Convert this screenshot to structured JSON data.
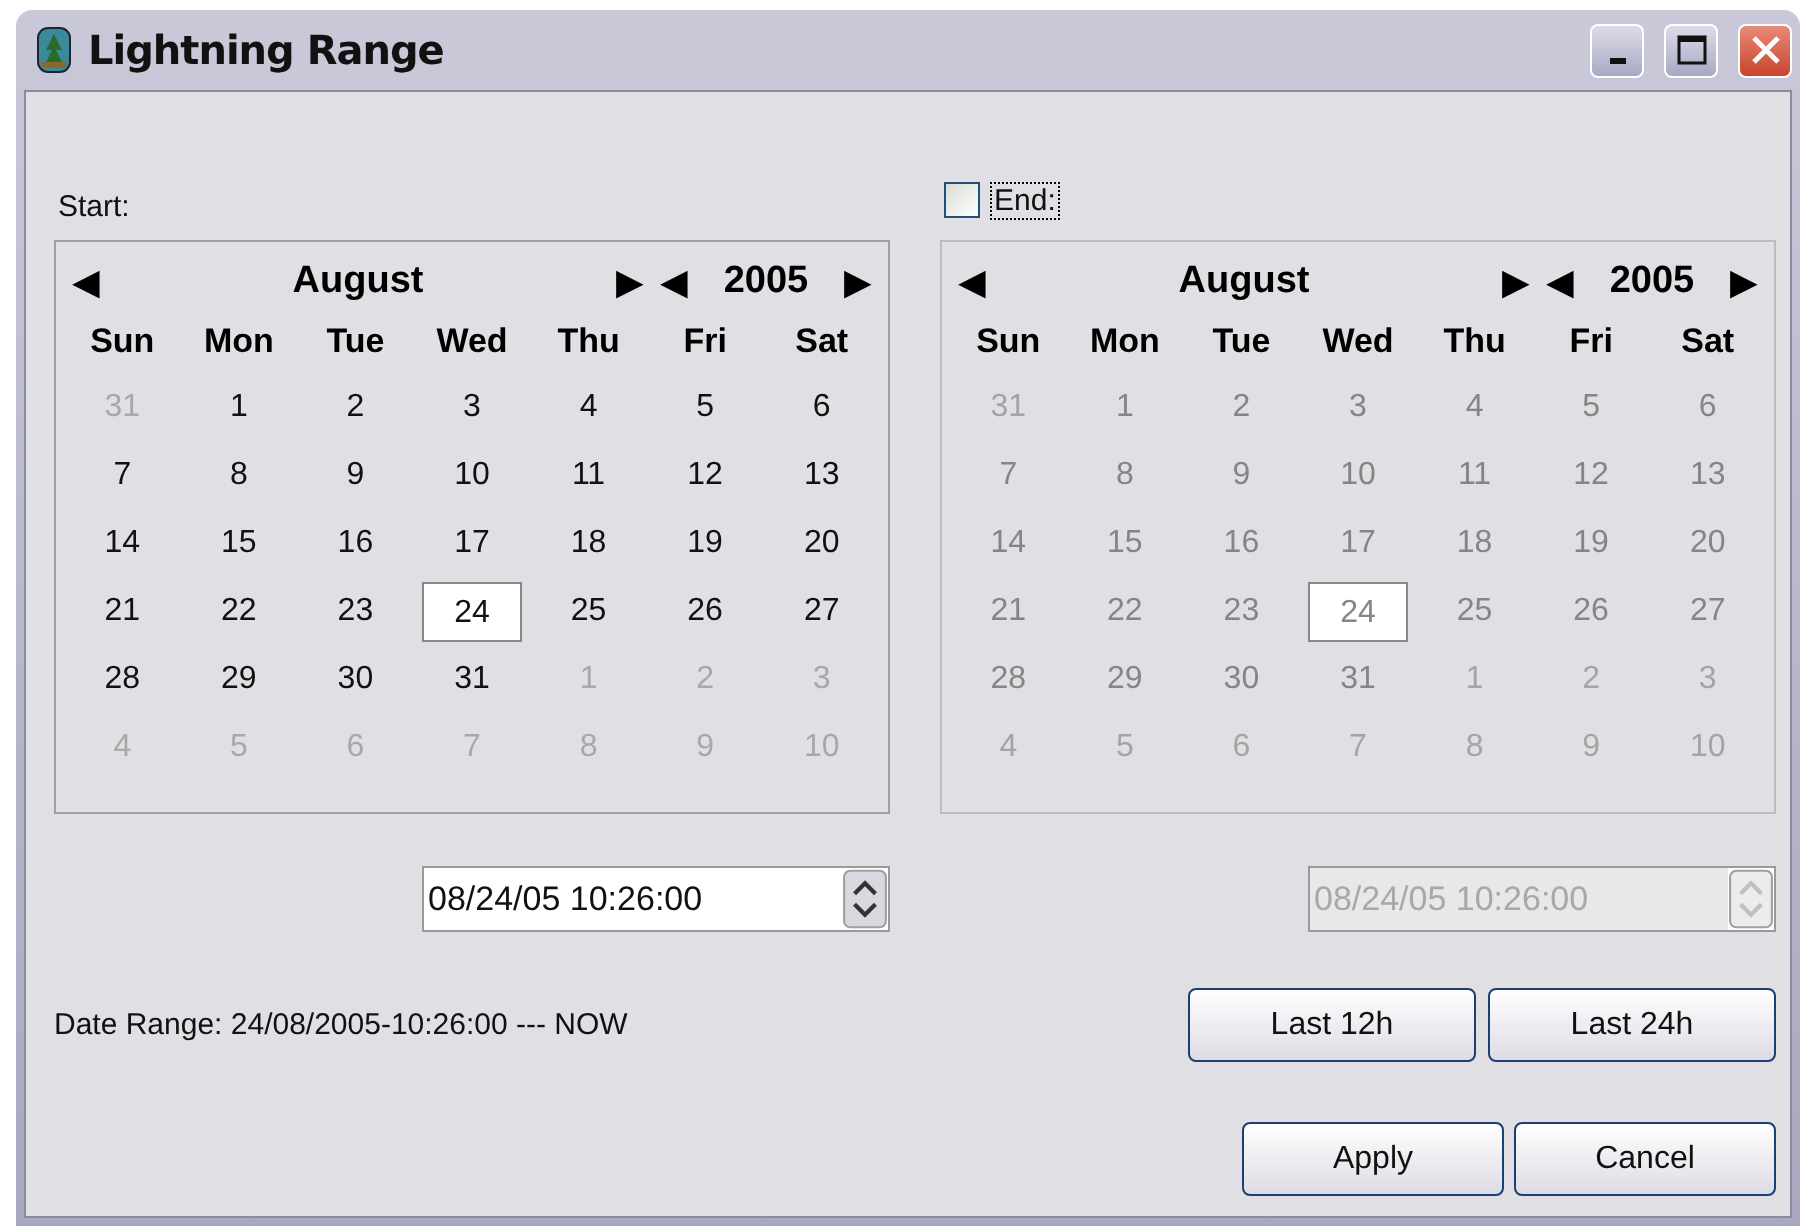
{
  "window": {
    "title": "Lightning Range"
  },
  "calendars": [
    {
      "header": {
        "kind": "label",
        "text": "Start:"
      },
      "disabled": false,
      "prev_month": "◀",
      "month": "August",
      "next_month": "▶",
      "prev_year": "◀",
      "year": "2005",
      "next_year": "▶",
      "weekdays": [
        "Sun",
        "Mon",
        "Tue",
        "Wed",
        "Thu",
        "Fri",
        "Sat"
      ],
      "weeks": [
        [
          {
            "d": "31",
            "outside": true,
            "selected": false
          },
          {
            "d": "1",
            "outside": false,
            "selected": false
          },
          {
            "d": "2",
            "outside": false,
            "selected": false
          },
          {
            "d": "3",
            "outside": false,
            "selected": false
          },
          {
            "d": "4",
            "outside": false,
            "selected": false
          },
          {
            "d": "5",
            "outside": false,
            "selected": false
          },
          {
            "d": "6",
            "outside": false,
            "selected": false
          }
        ],
        [
          {
            "d": "7",
            "outside": false,
            "selected": false
          },
          {
            "d": "8",
            "outside": false,
            "selected": false
          },
          {
            "d": "9",
            "outside": false,
            "selected": false
          },
          {
            "d": "10",
            "outside": false,
            "selected": false
          },
          {
            "d": "11",
            "outside": false,
            "selected": false
          },
          {
            "d": "12",
            "outside": false,
            "selected": false
          },
          {
            "d": "13",
            "outside": false,
            "selected": false
          }
        ],
        [
          {
            "d": "14",
            "outside": false,
            "selected": false
          },
          {
            "d": "15",
            "outside": false,
            "selected": false
          },
          {
            "d": "16",
            "outside": false,
            "selected": false
          },
          {
            "d": "17",
            "outside": false,
            "selected": false
          },
          {
            "d": "18",
            "outside": false,
            "selected": false
          },
          {
            "d": "19",
            "outside": false,
            "selected": false
          },
          {
            "d": "20",
            "outside": false,
            "selected": false
          }
        ],
        [
          {
            "d": "21",
            "outside": false,
            "selected": false
          },
          {
            "d": "22",
            "outside": false,
            "selected": false
          },
          {
            "d": "23",
            "outside": false,
            "selected": false
          },
          {
            "d": "24",
            "outside": false,
            "selected": true
          },
          {
            "d": "25",
            "outside": false,
            "selected": false
          },
          {
            "d": "26",
            "outside": false,
            "selected": false
          },
          {
            "d": "27",
            "outside": false,
            "selected": false
          }
        ],
        [
          {
            "d": "28",
            "outside": false,
            "selected": false
          },
          {
            "d": "29",
            "outside": false,
            "selected": false
          },
          {
            "d": "30",
            "outside": false,
            "selected": false
          },
          {
            "d": "31",
            "outside": false,
            "selected": false
          },
          {
            "d": "1",
            "outside": true,
            "selected": false
          },
          {
            "d": "2",
            "outside": true,
            "selected": false
          },
          {
            "d": "3",
            "outside": true,
            "selected": false
          }
        ],
        [
          {
            "d": "4",
            "outside": true,
            "selected": false
          },
          {
            "d": "5",
            "outside": true,
            "selected": false
          },
          {
            "d": "6",
            "outside": true,
            "selected": false
          },
          {
            "d": "7",
            "outside": true,
            "selected": false
          },
          {
            "d": "8",
            "outside": true,
            "selected": false
          },
          {
            "d": "9",
            "outside": true,
            "selected": false
          },
          {
            "d": "10",
            "outside": true,
            "selected": false
          }
        ]
      ],
      "datetime": "08/24/05 10:26:00"
    },
    {
      "header": {
        "kind": "checkbox",
        "text": "End:",
        "checked": false
      },
      "disabled": true,
      "prev_month": "◀",
      "month": "August",
      "next_month": "▶",
      "prev_year": "◀",
      "year": "2005",
      "next_year": "▶",
      "weekdays": [
        "Sun",
        "Mon",
        "Tue",
        "Wed",
        "Thu",
        "Fri",
        "Sat"
      ],
      "weeks": [
        [
          {
            "d": "31",
            "outside": true,
            "selected": false
          },
          {
            "d": "1",
            "outside": false,
            "selected": false
          },
          {
            "d": "2",
            "outside": false,
            "selected": false
          },
          {
            "d": "3",
            "outside": false,
            "selected": false
          },
          {
            "d": "4",
            "outside": false,
            "selected": false
          },
          {
            "d": "5",
            "outside": false,
            "selected": false
          },
          {
            "d": "6",
            "outside": false,
            "selected": false
          }
        ],
        [
          {
            "d": "7",
            "outside": false,
            "selected": false
          },
          {
            "d": "8",
            "outside": false,
            "selected": false
          },
          {
            "d": "9",
            "outside": false,
            "selected": false
          },
          {
            "d": "10",
            "outside": false,
            "selected": false
          },
          {
            "d": "11",
            "outside": false,
            "selected": false
          },
          {
            "d": "12",
            "outside": false,
            "selected": false
          },
          {
            "d": "13",
            "outside": false,
            "selected": false
          }
        ],
        [
          {
            "d": "14",
            "outside": false,
            "selected": false
          },
          {
            "d": "15",
            "outside": false,
            "selected": false
          },
          {
            "d": "16",
            "outside": false,
            "selected": false
          },
          {
            "d": "17",
            "outside": false,
            "selected": false
          },
          {
            "d": "18",
            "outside": false,
            "selected": false
          },
          {
            "d": "19",
            "outside": false,
            "selected": false
          },
          {
            "d": "20",
            "outside": false,
            "selected": false
          }
        ],
        [
          {
            "d": "21",
            "outside": false,
            "selected": false
          },
          {
            "d": "22",
            "outside": false,
            "selected": false
          },
          {
            "d": "23",
            "outside": false,
            "selected": false
          },
          {
            "d": "24",
            "outside": false,
            "selected": true
          },
          {
            "d": "25",
            "outside": false,
            "selected": false
          },
          {
            "d": "26",
            "outside": false,
            "selected": false
          },
          {
            "d": "27",
            "outside": false,
            "selected": false
          }
        ],
        [
          {
            "d": "28",
            "outside": false,
            "selected": false
          },
          {
            "d": "29",
            "outside": false,
            "selected": false
          },
          {
            "d": "30",
            "outside": false,
            "selected": false
          },
          {
            "d": "31",
            "outside": false,
            "selected": false
          },
          {
            "d": "1",
            "outside": true,
            "selected": false
          },
          {
            "d": "2",
            "outside": true,
            "selected": false
          },
          {
            "d": "3",
            "outside": true,
            "selected": false
          }
        ],
        [
          {
            "d": "4",
            "outside": true,
            "selected": false
          },
          {
            "d": "5",
            "outside": true,
            "selected": false
          },
          {
            "d": "6",
            "outside": true,
            "selected": false
          },
          {
            "d": "7",
            "outside": true,
            "selected": false
          },
          {
            "d": "8",
            "outside": true,
            "selected": false
          },
          {
            "d": "9",
            "outside": true,
            "selected": false
          },
          {
            "d": "10",
            "outside": true,
            "selected": false
          }
        ]
      ],
      "datetime": "08/24/05 10:26:00"
    }
  ],
  "date_range": "Date Range: 24/08/2005-10:26:00 --- NOW",
  "quick_buttons": [
    "Last 12h",
    "Last 24h"
  ],
  "buttons": [
    "Apply",
    "Cancel"
  ]
}
